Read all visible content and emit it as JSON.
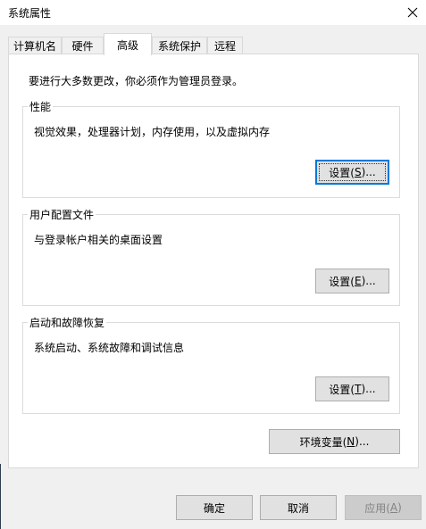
{
  "window": {
    "title": "系统属性"
  },
  "tabs": [
    {
      "label": "计算机名",
      "active": false
    },
    {
      "label": "硬件",
      "active": false
    },
    {
      "label": "高级",
      "active": true
    },
    {
      "label": "系统保护",
      "active": false
    },
    {
      "label": "远程",
      "active": false
    }
  ],
  "advanced": {
    "intro": "要进行大多数更改，你必须作为管理员登录。",
    "performance": {
      "title": "性能",
      "description": "视觉效果，处理器计划，内存使用，以及虚拟内存",
      "button_prefix": "设置(",
      "button_key": "S",
      "button_suffix": ")..."
    },
    "user_profiles": {
      "title": "用户配置文件",
      "description": "与登录帐户相关的桌面设置",
      "button_prefix": "设置(",
      "button_key": "E",
      "button_suffix": ")..."
    },
    "startup_recovery": {
      "title": "启动和故障恢复",
      "description": "系统启动、系统故障和调试信息",
      "button_prefix": "设置(",
      "button_key": "T",
      "button_suffix": ")..."
    },
    "env_vars": {
      "button_prefix": "环境变量(",
      "button_key": "N",
      "button_suffix": ")..."
    }
  },
  "footer": {
    "ok_label": "确定",
    "cancel_label": "取消",
    "apply_prefix": "应用(",
    "apply_key": "A",
    "apply_suffix": ")"
  },
  "icons": {
    "close": "close-icon"
  },
  "colors": {
    "focus_border": "#0078d7",
    "button_bg": "#e1e1e1",
    "window_bg": "#f0f0f0"
  }
}
